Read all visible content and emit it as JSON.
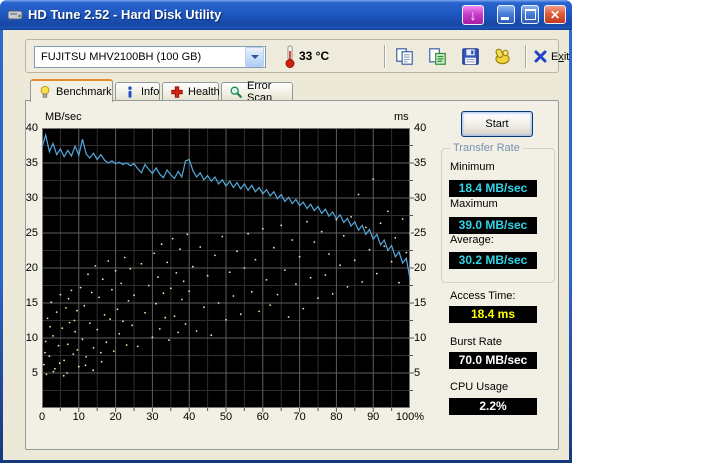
{
  "window": {
    "title": "HD Tune 2.52 - Hard Disk Utility"
  },
  "icons": {
    "app": "hard-disk-utility",
    "download_glyph": "↓",
    "minimize": "minimize-bar",
    "maximize": "maximize-box",
    "close_glyph": "✕",
    "thermometer": "thermometer",
    "copy": "copy-pages",
    "export": "copy-report-pages",
    "save": "floppy-disk",
    "donate": "hand-with-coin",
    "exit_x": "blue-x",
    "benchmark": "lightbulb",
    "info": "info-letter",
    "health": "red-cross",
    "error_scan": "magnifier"
  },
  "toolbar": {
    "drive_select": "FUJITSU MHV2100BH (100 GB)",
    "temperature": "33 °C",
    "exit": {
      "pre": "E",
      "key": "x",
      "post": "it"
    }
  },
  "tabs": [
    {
      "label": "Benchmark",
      "active": true
    },
    {
      "label": "Info",
      "active": false
    },
    {
      "label": "Health",
      "active": false
    },
    {
      "label": "Error Scan",
      "active": false
    }
  ],
  "results": {
    "start_button": "Start",
    "transfer_rate": {
      "legend": "Transfer Rate",
      "minimum_label": "Minimum",
      "minimum_value": "18.4 MB/sec",
      "maximum_label": "Maximum",
      "maximum_value": "39.0 MB/sec",
      "average_label": "Average:",
      "average_value": "30.2 MB/sec"
    },
    "access_time_label": "Access Time:",
    "access_time_value": "18.4 ms",
    "burst_rate_label": "Burst Rate",
    "burst_rate_value": "70.0 MB/sec",
    "cpu_usage_label": "CPU Usage",
    "cpu_usage_value": "2.2%"
  },
  "value_colors": {
    "transfer": "#30D5E8",
    "access": "#FFFF00",
    "burst": "#FFFFFF",
    "cpu": "#FFFFFF"
  },
  "chart_data": {
    "type": "line",
    "title": "HD Tune benchmark: transfer rate line with access time scatter",
    "left_axis_label": "MB/sec",
    "right_axis_label": "ms",
    "xlabel_unit": "% of disk capacity",
    "xlim": [
      0,
      100
    ],
    "ylim": [
      0,
      40
    ],
    "x_tick_labels": [
      "0",
      "10",
      "20",
      "30",
      "40",
      "50",
      "60",
      "70",
      "80",
      "90",
      "100%"
    ],
    "y_tick_values": [
      40,
      35,
      30,
      25,
      20,
      15,
      10,
      5
    ],
    "grid": {
      "plot_bg": "#000000",
      "major": "#5E5E5E",
      "minor": "#2E2E2E",
      "border": "#787878",
      "tick": "#555555"
    },
    "legend_position": "none",
    "series": [
      {
        "name": "transfer-rate-line",
        "type": "line",
        "color": "#55AADF",
        "x_start": 0,
        "x_step": 1,
        "y": [
          37.3,
          39.0,
          36.6,
          37.8,
          36.2,
          37.0,
          35.9,
          36.8,
          36.0,
          37.4,
          36.1,
          38.4,
          36.3,
          35.7,
          36.4,
          35.5,
          36.2,
          35.4,
          35.0,
          35.3,
          34.9,
          35.1,
          34.8,
          35.0,
          34.6,
          34.9,
          34.2,
          33.6,
          34.8,
          34.1,
          33.5,
          34.3,
          33.4,
          32.9,
          34.0,
          33.3,
          32.8,
          33.8,
          33.0,
          35.3,
          35.5,
          33.9,
          33.0,
          33.6,
          32.6,
          33.2,
          32.4,
          33.0,
          32.0,
          32.6,
          31.7,
          32.4,
          31.5,
          32.2,
          31.3,
          32.0,
          31.1,
          31.8,
          30.9,
          31.5,
          30.6,
          31.2,
          30.3,
          30.9,
          29.9,
          30.5,
          29.5,
          30.1,
          29.2,
          29.8,
          28.9,
          29.4,
          28.5,
          29.1,
          28.2,
          28.8,
          27.8,
          28.4,
          27.4,
          28.0,
          27.0,
          27.6,
          26.5,
          27.1,
          26.0,
          26.6,
          25.4,
          26.1,
          24.8,
          25.5,
          24.1,
          24.8,
          23.3,
          24.0,
          22.5,
          23.2,
          21.6,
          22.3,
          20.7,
          21.4,
          18.4
        ]
      },
      {
        "name": "access-time-scatter",
        "type": "scatter",
        "color": "#EDEDA2",
        "points": [
          [
            0.5,
            6.2
          ],
          [
            1,
            9.5
          ],
          [
            1.5,
            12.8
          ],
          [
            2,
            7.4
          ],
          [
            2.5,
            15.1
          ],
          [
            3,
            10.3
          ],
          [
            3.5,
            5.6
          ],
          [
            4,
            13.7
          ],
          [
            4.5,
            8.9
          ],
          [
            5,
            16.2
          ],
          [
            5.5,
            11.4
          ],
          [
            6,
            6.8
          ],
          [
            6.5,
            14.3
          ],
          [
            7,
            9.1
          ],
          [
            7.5,
            12.2
          ],
          [
            8,
            16.8
          ],
          [
            8.5,
            7.7
          ],
          [
            9,
            10.9
          ],
          [
            9.5,
            13.9
          ],
          [
            10,
            5.9
          ],
          [
            2.2,
            11.6
          ],
          [
            4.8,
            6.4
          ],
          [
            7.2,
            15.6
          ],
          [
            8.8,
            12.5
          ],
          [
            9.6,
            8.3
          ],
          [
            1.2,
            4.8
          ],
          [
            3.1,
            5.2
          ],
          [
            5.9,
            4.6
          ],
          [
            11.8,
            6.1
          ],
          [
            13.9,
            5.4
          ],
          [
            16.2,
            6.6
          ],
          [
            0.8,
            7.9
          ],
          [
            6.8,
            5.0
          ],
          [
            10.5,
            17.2
          ],
          [
            11,
            9.8
          ],
          [
            11.5,
            14.6
          ],
          [
            12,
            7.3
          ],
          [
            12.5,
            19.1
          ],
          [
            13,
            12.1
          ],
          [
            13.5,
            16.5
          ],
          [
            14,
            8.6
          ],
          [
            14.5,
            20.3
          ],
          [
            15,
            11.2
          ],
          [
            15.5,
            15.8
          ],
          [
            16,
            7.9
          ],
          [
            16.5,
            18.4
          ],
          [
            17,
            13.3
          ],
          [
            17.5,
            9.4
          ],
          [
            18,
            21.0
          ],
          [
            18.5,
            12.7
          ],
          [
            19,
            16.9
          ],
          [
            19.5,
            8.1
          ],
          [
            20,
            19.6
          ],
          [
            20.5,
            14.1
          ],
          [
            21,
            10.6
          ],
          [
            21.5,
            17.8
          ],
          [
            22,
            12.4
          ],
          [
            22.5,
            21.5
          ],
          [
            23,
            9.0
          ],
          [
            23.5,
            15.3
          ],
          [
            24,
            19.9
          ],
          [
            24.5,
            11.8
          ],
          [
            25,
            16.1
          ],
          [
            26,
            8.8
          ],
          [
            27,
            20.6
          ],
          [
            28,
            13.6
          ],
          [
            29,
            17.5
          ],
          [
            30,
            10.1
          ],
          [
            30.5,
            22.1
          ],
          [
            31,
            14.9
          ],
          [
            31.5,
            18.7
          ],
          [
            32,
            11.3
          ],
          [
            32.5,
            23.4
          ],
          [
            33,
            16.4
          ],
          [
            33.5,
            12.9
          ],
          [
            34,
            20.8
          ],
          [
            34.5,
            9.7
          ],
          [
            35,
            17.1
          ],
          [
            35.5,
            24.2
          ],
          [
            36,
            13.1
          ],
          [
            36.5,
            19.3
          ],
          [
            37,
            10.8
          ],
          [
            37.5,
            22.7
          ],
          [
            38,
            15.5
          ],
          [
            38.5,
            18.1
          ],
          [
            39,
            12.0
          ],
          [
            39.5,
            24.8
          ],
          [
            40,
            16.7
          ],
          [
            41,
            20.2
          ],
          [
            42,
            11.0
          ],
          [
            43,
            23.0
          ],
          [
            44,
            14.4
          ],
          [
            45,
            18.9
          ],
          [
            46,
            10.4
          ],
          [
            47,
            21.8
          ],
          [
            48,
            15.0
          ],
          [
            49,
            24.5
          ],
          [
            50,
            12.6
          ],
          [
            51,
            19.4
          ],
          [
            52,
            16.0
          ],
          [
            53,
            22.4
          ],
          [
            54,
            13.4
          ],
          [
            55,
            20.0
          ],
          [
            56,
            24.9
          ],
          [
            57,
            16.6
          ],
          [
            58,
            21.2
          ],
          [
            59,
            13.8
          ],
          [
            60,
            25.6
          ],
          [
            61,
            18.3
          ],
          [
            62,
            14.7
          ],
          [
            63,
            22.9
          ],
          [
            64,
            16.2
          ],
          [
            65,
            26.1
          ],
          [
            66,
            19.7
          ],
          [
            67,
            13.0
          ],
          [
            68,
            24.0
          ],
          [
            69,
            17.7
          ],
          [
            70,
            21.6
          ],
          [
            71,
            14.2
          ],
          [
            72,
            26.6
          ],
          [
            73,
            18.6
          ],
          [
            74,
            23.7
          ],
          [
            75,
            15.7
          ],
          [
            76,
            25.2
          ],
          [
            77,
            19.0
          ],
          [
            78,
            22.0
          ],
          [
            79,
            16.3
          ],
          [
            80,
            26.9
          ],
          [
            81,
            20.4
          ],
          [
            82,
            24.6
          ],
          [
            83,
            17.3
          ],
          [
            84,
            27.3
          ],
          [
            85,
            21.1
          ],
          [
            86,
            30.5
          ],
          [
            87,
            18.0
          ],
          [
            88,
            25.8
          ],
          [
            89,
            22.6
          ],
          [
            90,
            32.7
          ],
          [
            91,
            19.2
          ],
          [
            92,
            26.4
          ],
          [
            93,
            23.1
          ],
          [
            94,
            28.1
          ],
          [
            95,
            20.9
          ],
          [
            96,
            24.3
          ],
          [
            97,
            17.9
          ],
          [
            98,
            27.0
          ],
          [
            99,
            22.2
          ],
          [
            100,
            25.0
          ]
        ]
      }
    ]
  }
}
